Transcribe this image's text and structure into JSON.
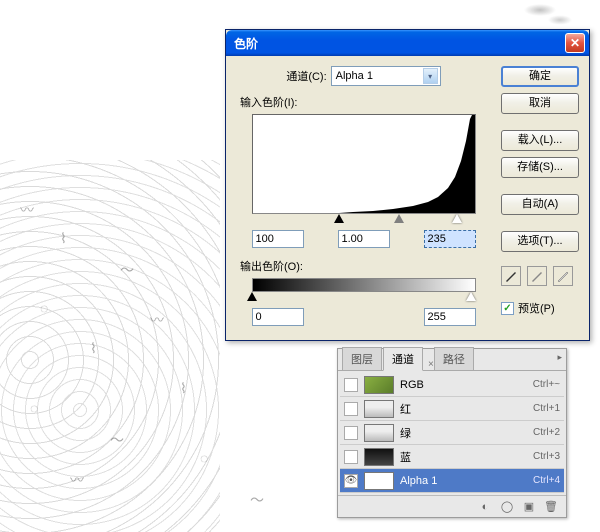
{
  "dialog": {
    "title": "色阶",
    "channel_label": "通道(C):",
    "channel_value": "Alpha 1",
    "input_levels_label": "输入色阶(I):",
    "input_black": "100",
    "input_gamma": "1.00",
    "input_white": "235",
    "output_levels_label": "输出色阶(O):",
    "output_black": "0",
    "output_white": "255",
    "preview_label": "预览(P)"
  },
  "buttons": {
    "ok": "确定",
    "cancel": "取消",
    "load": "载入(L)...",
    "save": "存储(S)...",
    "auto": "自动(A)",
    "options": "选项(T)..."
  },
  "panel": {
    "tab_layers": "图层",
    "tab_channels": "通道",
    "tab_paths": "路径",
    "channels": [
      {
        "name": "RGB",
        "shortcut": "Ctrl+~"
      },
      {
        "name": "红",
        "shortcut": "Ctrl+1"
      },
      {
        "name": "绿",
        "shortcut": "Ctrl+2"
      },
      {
        "name": "蓝",
        "shortcut": "Ctrl+3"
      },
      {
        "name": "Alpha 1",
        "shortcut": "Ctrl+4"
      }
    ]
  },
  "chart_data": {
    "type": "histogram",
    "title": "输入色阶",
    "xlabel": "",
    "ylabel": "",
    "xlim": [
      0,
      255
    ],
    "ylim": [
      0,
      1
    ],
    "input_range": [
      100,
      235
    ],
    "gamma": 1.0,
    "output_range": [
      0,
      255
    ],
    "values": [
      0,
      0,
      0,
      0,
      0,
      0,
      0,
      0,
      0,
      0,
      0,
      0,
      0,
      0,
      0,
      0,
      0,
      0,
      0,
      0,
      0,
      0,
      0,
      0,
      0,
      0,
      0,
      0,
      0,
      0,
      0,
      0,
      0,
      0,
      0,
      0,
      0,
      0,
      0,
      0,
      0,
      0,
      0,
      0,
      0,
      0,
      0,
      0,
      0,
      0,
      0,
      0,
      0,
      0,
      0,
      0,
      0,
      0,
      0,
      0,
      0,
      0,
      0,
      0,
      0,
      0,
      0,
      0,
      0,
      0,
      0,
      0,
      0,
      0,
      0,
      0,
      0,
      0,
      0,
      0,
      0,
      0,
      0,
      0,
      0,
      0,
      0,
      0,
      0,
      0,
      0,
      0,
      0,
      0,
      0,
      0,
      0,
      0,
      0,
      0,
      0.005,
      0.005,
      0.006,
      0.006,
      0.007,
      0.007,
      0.007,
      0.008,
      0.008,
      0.008,
      0.009,
      0.009,
      0.009,
      0.01,
      0.01,
      0.01,
      0.011,
      0.011,
      0.012,
      0.012,
      0.012,
      0.013,
      0.013,
      0.013,
      0.014,
      0.014,
      0.014,
      0.015,
      0.015,
      0.016,
      0.016,
      0.016,
      0.017,
      0.017,
      0.018,
      0.018,
      0.018,
      0.019,
      0.019,
      0.02,
      0.02,
      0.021,
      0.021,
      0.022,
      0.022,
      0.022,
      0.023,
      0.023,
      0.024,
      0.024,
      0.025,
      0.025,
      0.026,
      0.026,
      0.027,
      0.027,
      0.028,
      0.028,
      0.029,
      0.029,
      0.03,
      0.031,
      0.031,
      0.032,
      0.032,
      0.033,
      0.034,
      0.034,
      0.035,
      0.036,
      0.036,
      0.037,
      0.038,
      0.038,
      0.039,
      0.04,
      0.041,
      0.042,
      0.042,
      0.043,
      0.044,
      0.045,
      0.046,
      0.047,
      0.048,
      0.049,
      0.05,
      0.051,
      0.052,
      0.054,
      0.055,
      0.056,
      0.058,
      0.059,
      0.061,
      0.062,
      0.064,
      0.066,
      0.068,
      0.07,
      0.072,
      0.074,
      0.076,
      0.079,
      0.082,
      0.085,
      0.088,
      0.091,
      0.094,
      0.098,
      0.102,
      0.106,
      0.11,
      0.114,
      0.119,
      0.124,
      0.129,
      0.135,
      0.141,
      0.148,
      0.155,
      0.162,
      0.17,
      0.179,
      0.188,
      0.198,
      0.209,
      0.221,
      0.234,
      0.248,
      0.263,
      0.28,
      0.298,
      0.318,
      0.34,
      0.364,
      0.391,
      0.421,
      0.454,
      0.491,
      0.531,
      0.576,
      0.626,
      0.681,
      0.742,
      0.81,
      0.885,
      0.968,
      1.0,
      1.0,
      1.0,
      1.0,
      1.0,
      1.0,
      1.0,
      1.0
    ]
  }
}
